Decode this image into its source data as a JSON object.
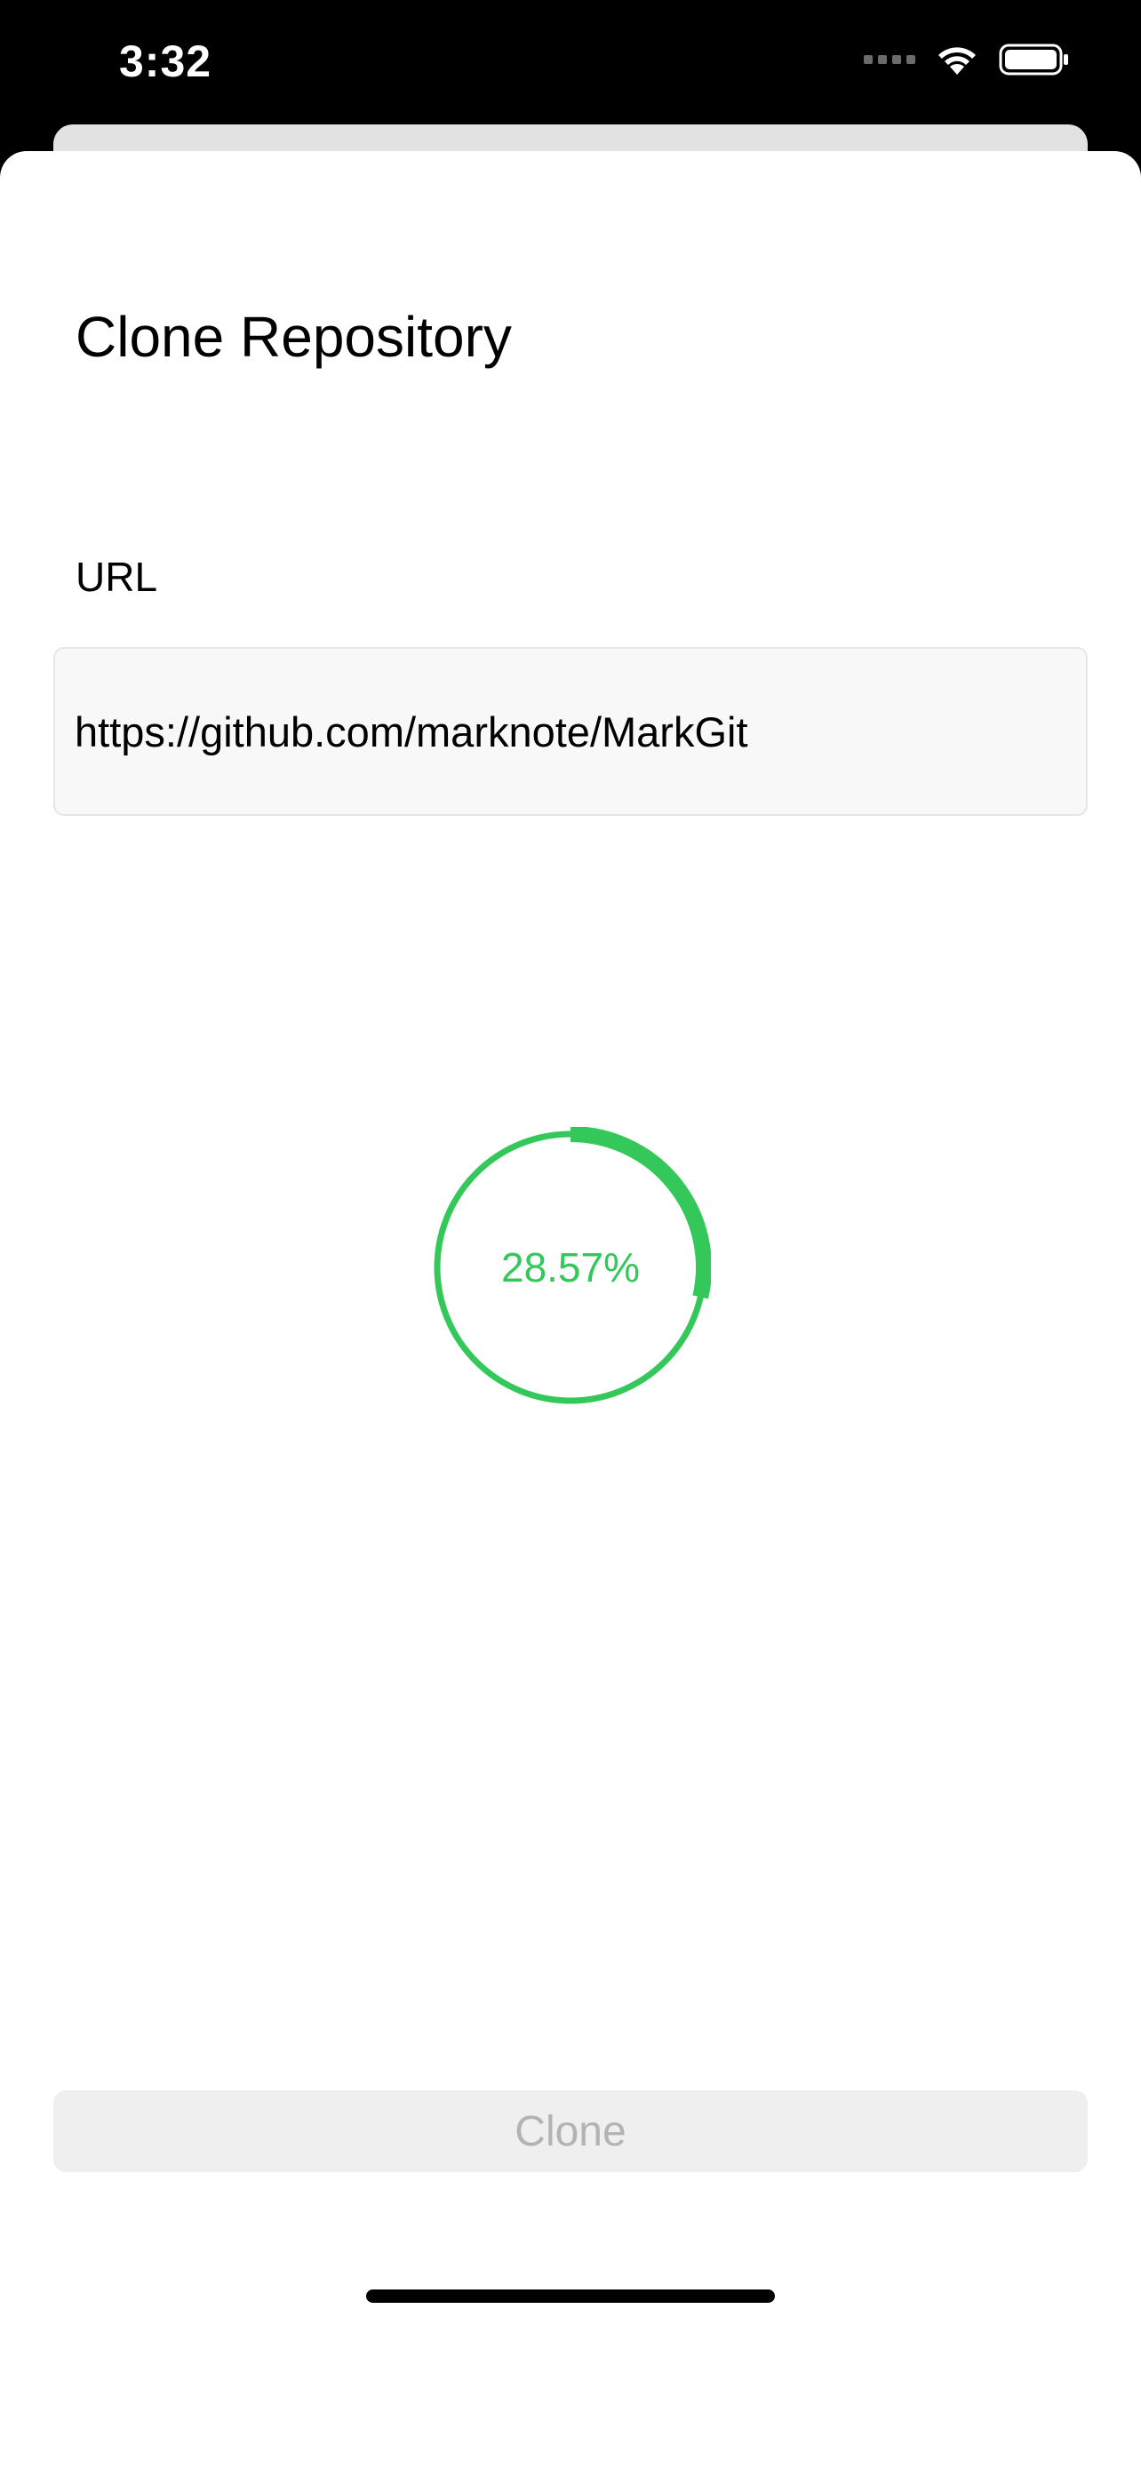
{
  "status_bar": {
    "time": "3:32",
    "icons": [
      "cellular-signal-icon",
      "wifi-icon",
      "battery-icon"
    ]
  },
  "sheet": {
    "title": "Clone Repository",
    "url_label": "URL",
    "url_value": "https://github.com/marknote/MarkGit"
  },
  "progress": {
    "value": 0.2857,
    "label": "28.57%"
  },
  "actions": {
    "clone_label": "Clone",
    "clone_enabled": false
  },
  "colors": {
    "accent_green": "#34c759",
    "disabled_text": "#b3b3b3",
    "disabled_bg": "#efefef",
    "field_bg": "#f8f8f8"
  }
}
